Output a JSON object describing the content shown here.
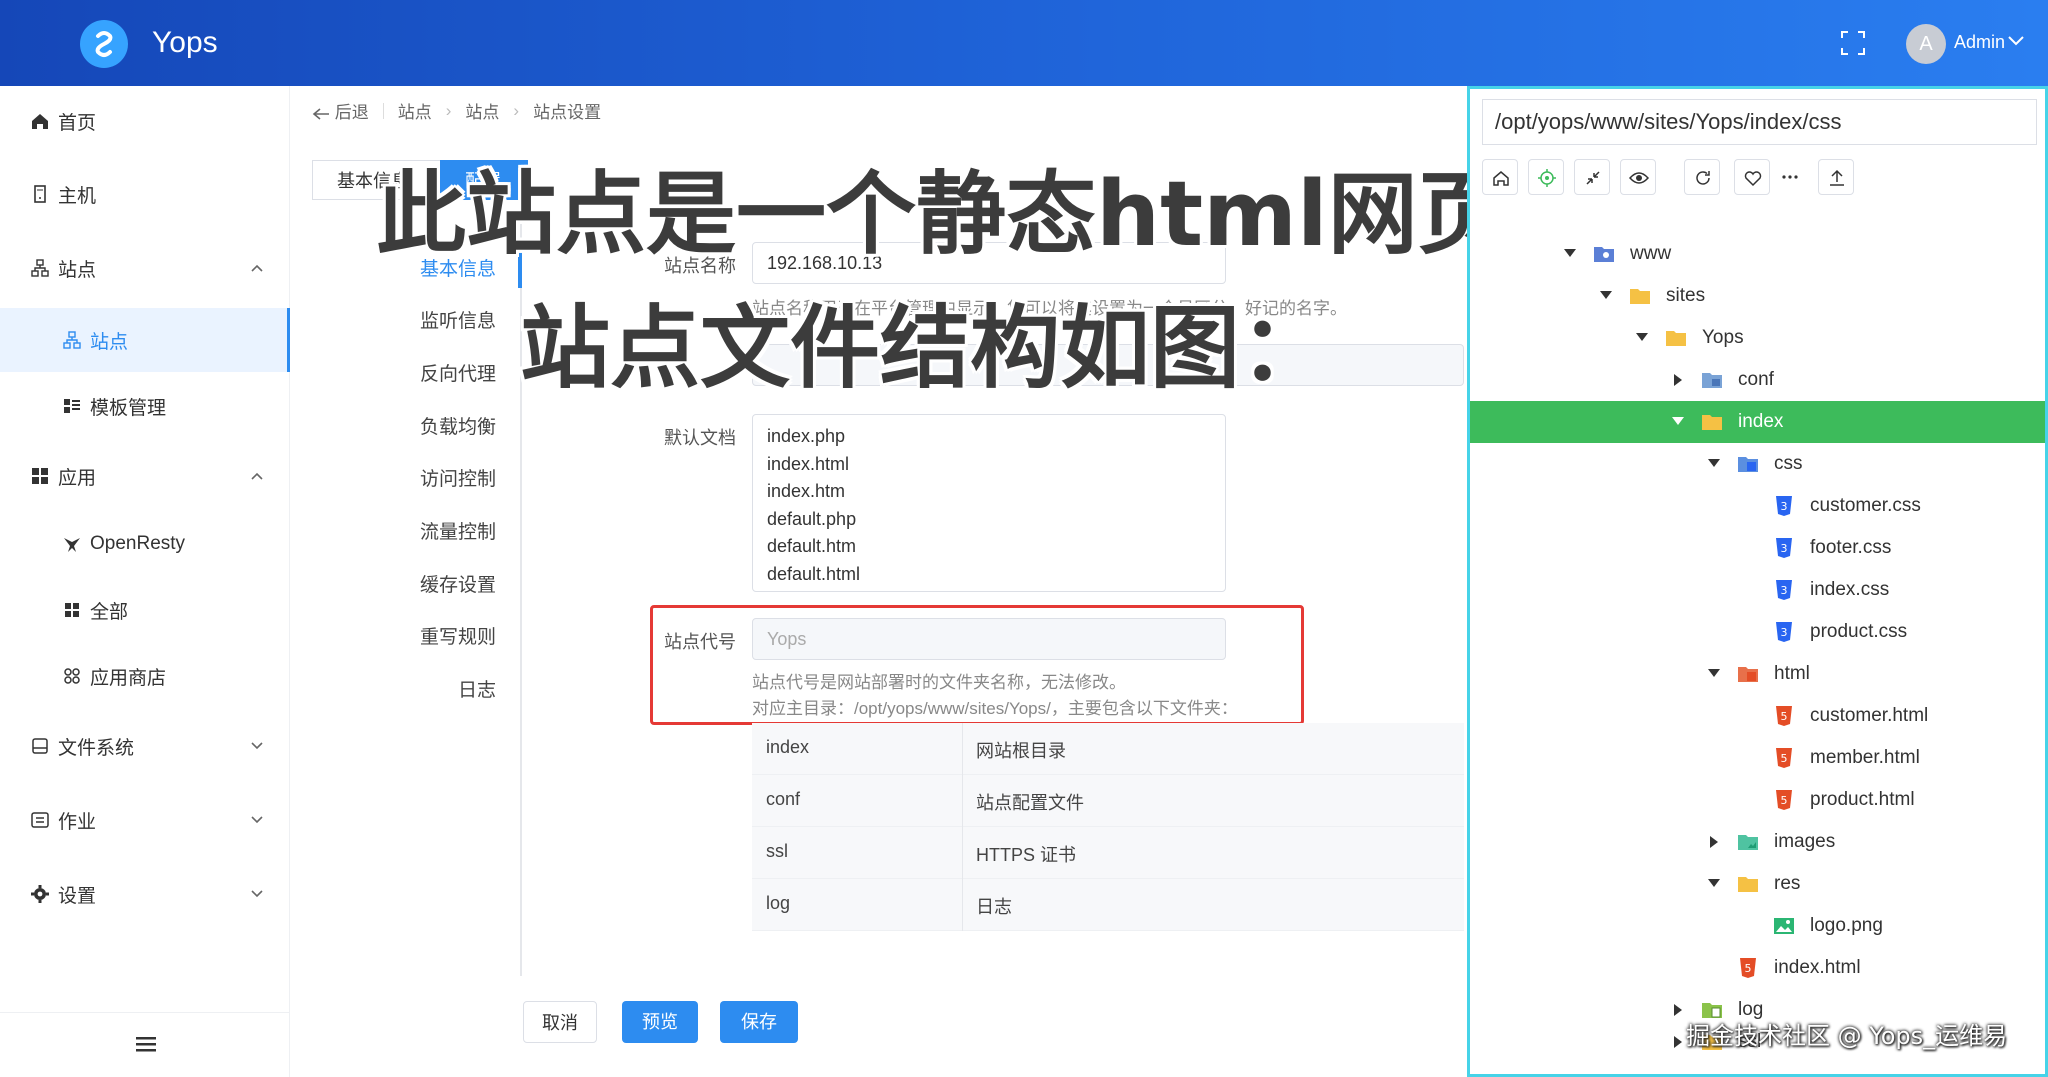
{
  "app": {
    "title": "Yops",
    "user_initial": "A",
    "user_name": "Admin"
  },
  "sidebar": {
    "items": [
      {
        "label": "首页"
      },
      {
        "label": "主机"
      },
      {
        "label": "站点"
      },
      {
        "label": "站点"
      },
      {
        "label": "模板管理"
      },
      {
        "label": "应用"
      },
      {
        "label": "OpenResty"
      },
      {
        "label": "全部"
      },
      {
        "label": "应用商店"
      },
      {
        "label": "文件系统"
      },
      {
        "label": "作业"
      },
      {
        "label": "设置"
      }
    ]
  },
  "breadcrumb": {
    "back": "后退",
    "items": [
      "站点",
      "站点",
      "站点设置"
    ]
  },
  "tabs": [
    "基本信息",
    "配置"
  ],
  "inner_menu": [
    "基本信息",
    "监听信息",
    "反向代理",
    "负载均衡",
    "访问控制",
    "流量控制",
    "缓存设置",
    "重写规则",
    "日志"
  ],
  "form": {
    "site_name_label": "站点名称",
    "site_name_value": "192.168.10.13",
    "site_name_hint": "站点名称用于在平台管理中显示，您可以将其设置为一个易区分、好记的名字。",
    "default_doc_label": "默认文档",
    "default_docs": [
      "index.php",
      "index.html",
      "index.htm",
      "default.php",
      "default.htm",
      "default.html"
    ],
    "site_code_label": "站点代号",
    "site_code_value": "Yops",
    "site_code_hint1": "站点代号是网站部署时的文件夹名称，无法修改。",
    "site_code_hint2": "对应主目录：/opt/yops/www/sites/Yops/，主要包含以下文件夹：",
    "dirs": [
      {
        "name": "index",
        "desc": "网站根目录"
      },
      {
        "name": "conf",
        "desc": "站点配置文件"
      },
      {
        "name": "ssl",
        "desc": "HTTPS 证书"
      },
      {
        "name": "log",
        "desc": "日志"
      }
    ]
  },
  "buttons": {
    "cancel": "取消",
    "preview": "预览",
    "save": "保存"
  },
  "overlay": {
    "line1": "此站点是一个静态html网页",
    "line2": "站点文件结构如图："
  },
  "file_panel": {
    "path": "/opt/yops/www/sites/Yops/index/css",
    "tree": [
      {
        "label": "www"
      },
      {
        "label": "sites"
      },
      {
        "label": "Yops"
      },
      {
        "label": "conf"
      },
      {
        "label": "index"
      },
      {
        "label": "css"
      },
      {
        "label": "customer.css"
      },
      {
        "label": "footer.css"
      },
      {
        "label": "index.css"
      },
      {
        "label": "product.css"
      },
      {
        "label": "html"
      },
      {
        "label": "customer.html"
      },
      {
        "label": "member.html"
      },
      {
        "label": "product.html"
      },
      {
        "label": "images"
      },
      {
        "label": "res"
      },
      {
        "label": "logo.png"
      },
      {
        "label": "index.html"
      },
      {
        "label": "log"
      },
      {
        "label": "ssl"
      }
    ]
  },
  "watermark": "掘金技术社区 @ Yops_运维易",
  "colors": {
    "primary": "#2d8cf0",
    "selected": "#3dbb5b",
    "highlight": "#e53935"
  }
}
